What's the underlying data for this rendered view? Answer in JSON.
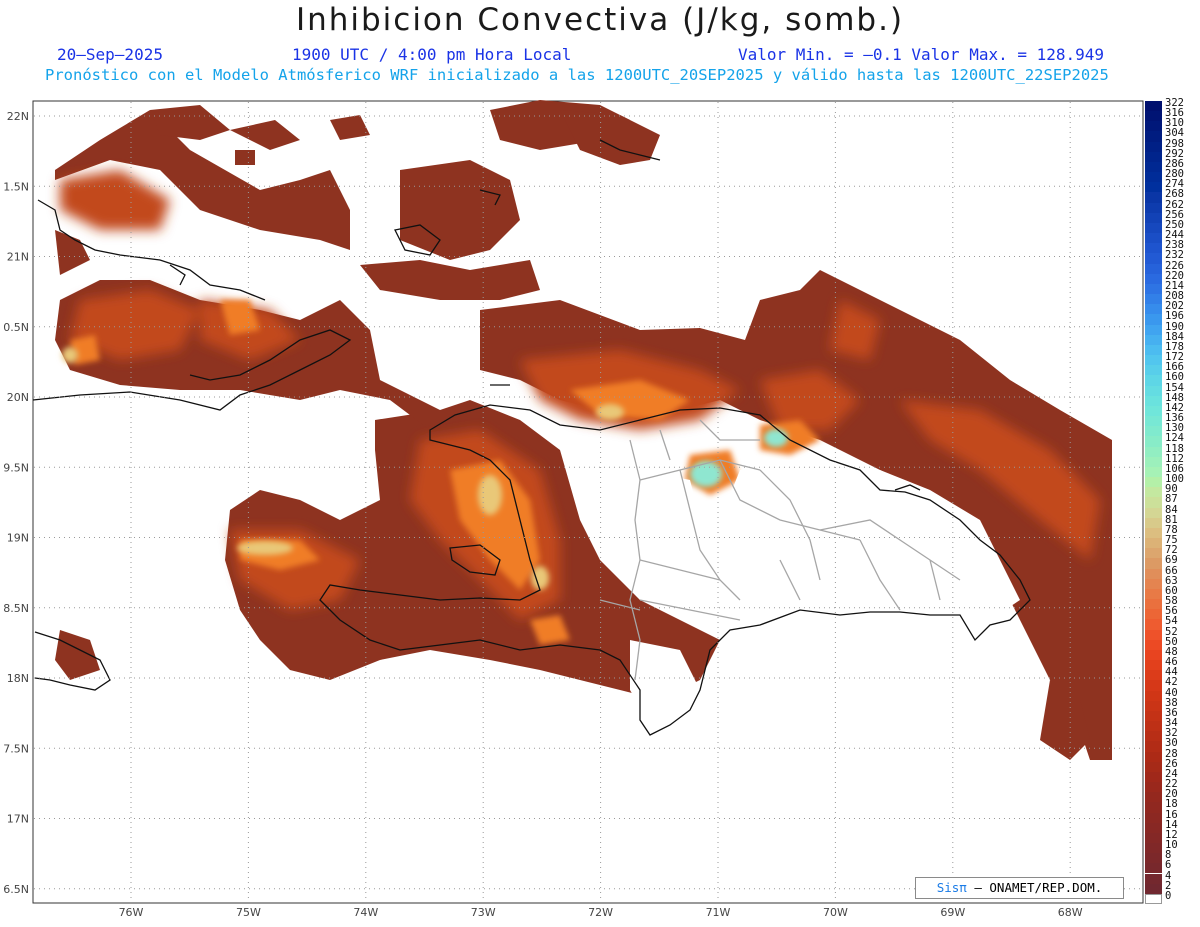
{
  "header": {
    "title": "Inhibicion Convectiva (J/kg, somb.)",
    "date": "20—Sep—2025",
    "time": "1900 UTC / 4:00 pm Hora Local",
    "min_max": "Valor Min. = —0.1  Valor Max. = 128.949",
    "subtitle": "Pronóstico con el Modelo Atmósferico WRF inicializado a las 1200UTC_20SEP2025 y válido hasta las  1200UTC_22SEP2025"
  },
  "map": {
    "lat_labels": [
      "22N",
      "1.5N",
      "21N",
      "0.5N",
      "20N",
      "9.5N",
      "19N",
      "8.5N",
      "18N",
      "7.5N",
      "17N",
      "6.5N"
    ],
    "lon_labels": [
      "76W",
      "75W",
      "74W",
      "73W",
      "72W",
      "71W",
      "70W",
      "69W",
      "68W"
    ],
    "lat_values": [
      22,
      21.5,
      21,
      20.5,
      20,
      19.5,
      19,
      18.5,
      18,
      17.5,
      17,
      16.5
    ],
    "lon_values": [
      -76,
      -75,
      -74,
      -73,
      -72,
      -71,
      -70,
      -69,
      -68
    ],
    "field_colors": {
      "low": "#8e3320",
      "mid": "#c24a1e",
      "high": "#f07d26",
      "peak": "#e9c878",
      "max": "#8fe6d0",
      "coast": "#111111",
      "border": "#a6a6a6"
    }
  },
  "legend": {
    "labels": [
      "322",
      "316",
      "310",
      "304",
      "298",
      "292",
      "286",
      "280",
      "274",
      "268",
      "262",
      "256",
      "250",
      "244",
      "238",
      "232",
      "226",
      "220",
      "214",
      "208",
      "202",
      "196",
      "190",
      "184",
      "178",
      "172",
      "166",
      "160",
      "154",
      "148",
      "142",
      "136",
      "130",
      "124",
      "118",
      "112",
      "106",
      "100",
      "90",
      "87",
      "84",
      "81",
      "78",
      "75",
      "72",
      "69",
      "66",
      "63",
      "60",
      "58",
      "56",
      "54",
      "52",
      "50",
      "48",
      "46",
      "44",
      "42",
      "40",
      "38",
      "36",
      "34",
      "32",
      "30",
      "28",
      "26",
      "24",
      "22",
      "20",
      "18",
      "16",
      "14",
      "12",
      "10",
      "8",
      "6",
      "4",
      "2",
      "0"
    ],
    "colors": [
      "#00106e",
      "#001474",
      "#00187a",
      "#001c80",
      "#002086",
      "#00248c",
      "#002892",
      "#002c98",
      "#00309e",
      "#0a36a6",
      "#0e3cae",
      "#1242b6",
      "#1648be",
      "#1a4ec6",
      "#1e54ce",
      "#225ad4",
      "#2662da",
      "#2a6ae0",
      "#2e74e4",
      "#3280e8",
      "#368cec",
      "#3a98ee",
      "#40a4f0",
      "#46b0f0",
      "#4cbcf0",
      "#52c6ee",
      "#58ceea",
      "#5ed6e6",
      "#64dce2",
      "#6ae2de",
      "#70e6da",
      "#78e8d4",
      "#80eace",
      "#88ecc8",
      "#92eec2",
      "#9cf0bc",
      "#a6f2b6",
      "#b4f0a8",
      "#c4e8a0",
      "#cce09a",
      "#d4d694",
      "#d8ca8a",
      "#dcbe80",
      "#dcb276",
      "#dca66e",
      "#dc9a64",
      "#e08e5a",
      "#e48450",
      "#e87a46",
      "#ea703e",
      "#ec6636",
      "#ee5c30",
      "#ee522a",
      "#ec4a24",
      "#e84420",
      "#e2401c",
      "#dc3c1a",
      "#d63818",
      "#d03616",
      "#ca3416",
      "#c43216",
      "#be3016",
      "#b82e16",
      "#b22c16",
      "#ac2a16",
      "#a62a18",
      "#a0281a",
      "#9a281c",
      "#94281e",
      "#902820",
      "#8c2822",
      "#882824",
      "#842826",
      "#802828",
      "#7c282a",
      "#78282c",
      "#74282e",
      "#702830",
      "#ffffff"
    ]
  },
  "credit": {
    "brand": "Sisπ",
    "text": "— ONAMET/REP.DOM."
  }
}
